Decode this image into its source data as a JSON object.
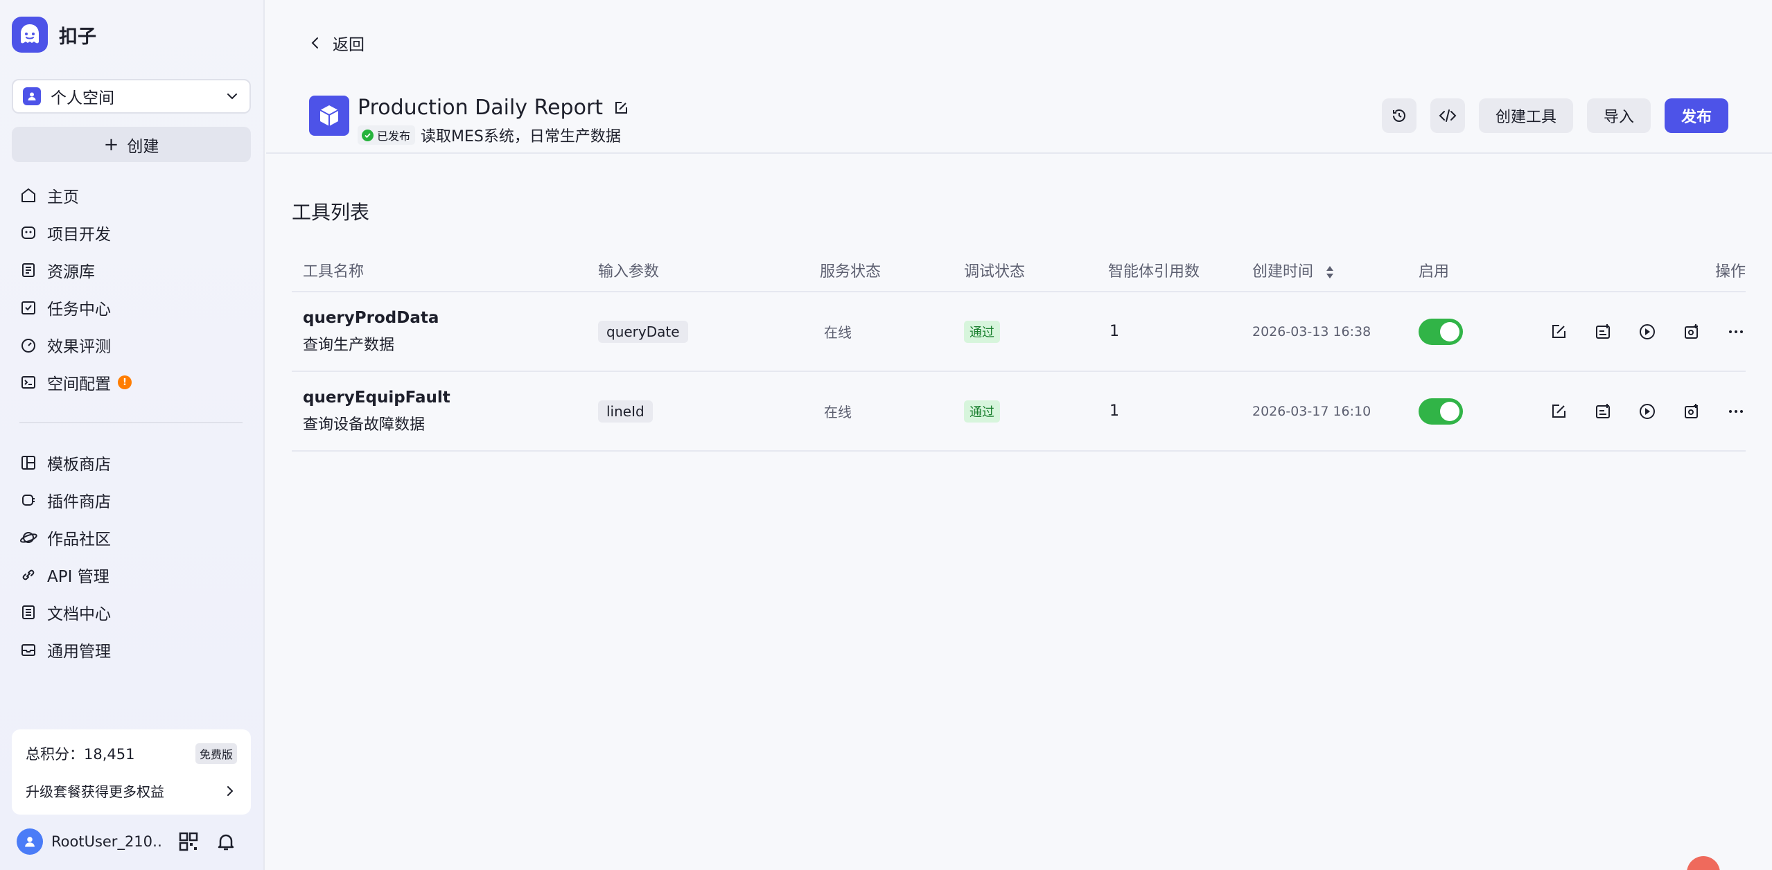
{
  "app": {
    "name": "扣子",
    "logo_icon": "coze-ghost-icon"
  },
  "space": {
    "label": "个人空间"
  },
  "create_label": "创建",
  "nav_primary": [
    {
      "label": "主页",
      "icon": "home-icon"
    },
    {
      "label": "项目开发",
      "icon": "bot-icon"
    },
    {
      "label": "资源库",
      "icon": "library-icon"
    },
    {
      "label": "任务中心",
      "icon": "task-icon"
    },
    {
      "label": "效果评测",
      "icon": "gauge-icon"
    },
    {
      "label": "空间配置",
      "icon": "terminal-icon",
      "badge": "!"
    }
  ],
  "nav_secondary": [
    {
      "label": "模板商店",
      "icon": "template-icon"
    },
    {
      "label": "插件商店",
      "icon": "plugin-icon"
    },
    {
      "label": "作品社区",
      "icon": "planet-icon"
    },
    {
      "label": "API 管理",
      "icon": "link-icon"
    },
    {
      "label": "文档中心",
      "icon": "doc-icon"
    },
    {
      "label": "通用管理",
      "icon": "inbox-icon"
    }
  ],
  "points": {
    "label": "总积分：18,451",
    "plan": "免费版",
    "upgrade": "升级套餐获得更多权益"
  },
  "user": {
    "name": "RootUser_210…"
  },
  "back_label": "返回",
  "plugin": {
    "title": "Production Daily Report",
    "status": "已发布",
    "description": "读取MES系统，日常生产数据"
  },
  "actions": {
    "create_tool": "创建工具",
    "import": "导入",
    "publish": "发布"
  },
  "section_title": "工具列表",
  "table": {
    "headers": {
      "name": "工具名称",
      "params": "输入参数",
      "service": "服务状态",
      "debug": "调试状态",
      "refs": "智能体引用数",
      "created": "创建时间",
      "enabled": "启用",
      "ops": "操作"
    },
    "rows": [
      {
        "name": "queryProdData",
        "desc": "查询生产数据",
        "param": "queryDate",
        "service": "在线",
        "debug": "通过",
        "refs": "1",
        "created": "2026-03-13 16:38",
        "enabled": true
      },
      {
        "name": "queryEquipFault",
        "desc": "查询设备故障数据",
        "param": "lineId",
        "service": "在线",
        "debug": "通过",
        "refs": "1",
        "created": "2026-03-17 16:10",
        "enabled": true
      }
    ]
  },
  "colors": {
    "accent": "#4d53e8",
    "success": "#31b447",
    "warning": "#ff7d00"
  }
}
